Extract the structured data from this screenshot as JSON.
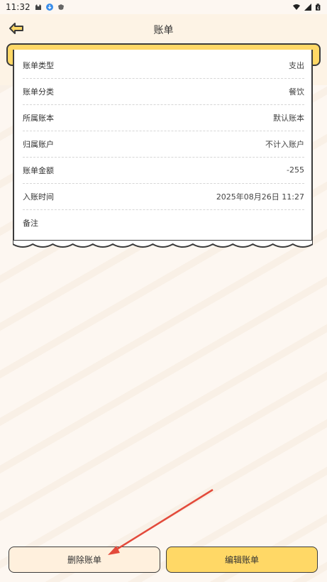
{
  "status_bar": {
    "time": "11:32"
  },
  "header": {
    "title": "账单"
  },
  "receipt": {
    "rows": [
      {
        "label": "账单类型",
        "value": "支出"
      },
      {
        "label": "账单分类",
        "value": "餐饮"
      },
      {
        "label": "所属账本",
        "value": "默认账本"
      },
      {
        "label": "归属账户",
        "value": "不计入账户"
      },
      {
        "label": "账单金额",
        "value": "-255"
      },
      {
        "label": "入账时间",
        "value": "2025年08月26日 11:27"
      },
      {
        "label": "备注",
        "value": ""
      }
    ]
  },
  "footer": {
    "delete_label": "删除账单",
    "edit_label": "编辑账单"
  },
  "colors": {
    "accent": "#ffd866",
    "outline": "#3b3b3b",
    "delete_bg": "#fff0dd",
    "annotation_arrow": "#e34a3b"
  }
}
